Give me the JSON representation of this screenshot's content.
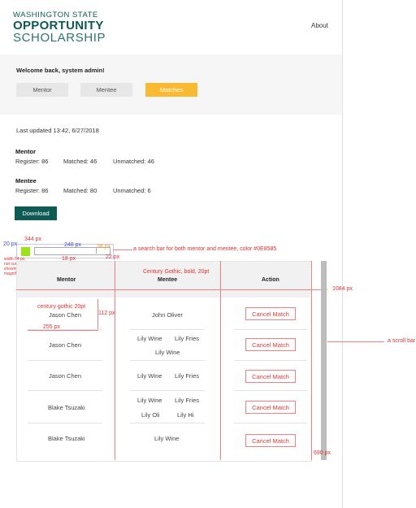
{
  "header": {
    "logo_line1": "WASHINGTON STATE",
    "logo_line2": "OPPORTUNITY",
    "logo_line3": "SCHOLARSHIP",
    "about": "About"
  },
  "welcome": {
    "message": "Welcome back, system admin!",
    "tabs": [
      "Mentor",
      "Mentee",
      "Matches"
    ],
    "active_tab": "Matches"
  },
  "stats": {
    "last_updated": "Last updated 13:42, 6/27/2018",
    "mentor_title": "Mentor",
    "mentor_register": "Register: 86",
    "mentor_matched": "Matched: 46",
    "mentor_unmatched": "Unmatched: 46",
    "mentee_title": "Mentee",
    "mentee_register": "Register: 86",
    "mentee_matched": "Matched: 80",
    "mentee_unmatched": "Unmatched: 6"
  },
  "download_label": "Download",
  "annotations": {
    "a20px": "20 px",
    "a344px": "344 px",
    "a248px": "248 px",
    "a38px": "38 px",
    "a18px": "18 px",
    "a22px": "22 px",
    "search_note": "a search bar for both mentor and mentee, color #0E8585",
    "icon_note1": "width 54 px,",
    "icon_note2": "not sure why it is not",
    "icon_note3": "showing in export, but it is the",
    "icon_note4": "magnifying glass icon in the drive",
    "font_note": "Century Gothic, bold, 20pt",
    "a1084px": "1084 px",
    "cg_note": "century gothic 20pt",
    "a112px": "112 px",
    "a255px": "255 px",
    "scroll_note": "a scroll bar",
    "a690px": "690 px"
  },
  "table": {
    "headers": [
      "Mentor",
      "Mentee",
      "Action"
    ],
    "rows": [
      {
        "mentor": "Jason Chen",
        "mentees": [
          "John Oliver"
        ],
        "action": "Cancel Match"
      },
      {
        "mentor": "Jason Chen",
        "mentees": [
          "Lily Wine",
          "Lily Fries",
          "Lily Wine"
        ],
        "action": "Cancel Match"
      },
      {
        "mentor": "Jason Chen",
        "mentees": [
          "Lily Wine",
          "Lily Fries"
        ],
        "action": "Cancel Match"
      },
      {
        "mentor": "Blake Tsuzaki",
        "mentees": [
          "Lily Wine",
          "Lily Fries",
          "Lily Oli",
          "Lily Hi"
        ],
        "action": "Cancel Match"
      },
      {
        "mentor": "Blake Tsuzaki",
        "mentees": [
          "Lily Wine"
        ],
        "action": "Cancel Match"
      }
    ]
  },
  "colors": {
    "brand": "#0e5a55",
    "accent": "#f9b930",
    "annotation": "#e03030",
    "search_icon": "#9be318"
  }
}
